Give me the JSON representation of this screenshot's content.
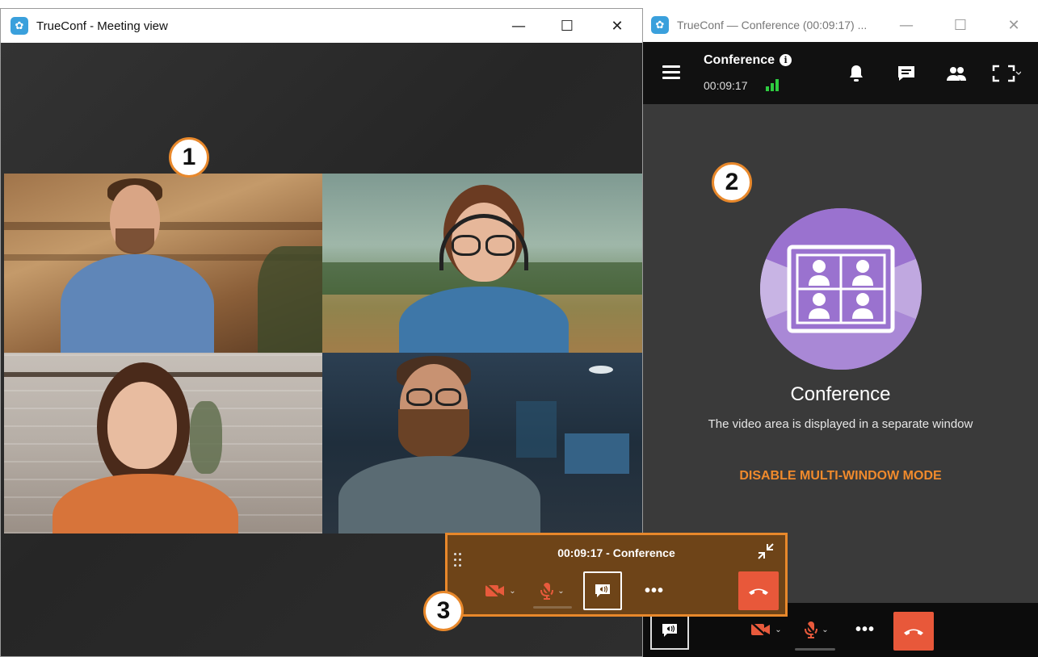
{
  "meeting_window": {
    "title": "TrueConf - Meeting view",
    "controls": {
      "minimize": "—",
      "maximize": "☐",
      "close": "✕"
    },
    "badge": "1"
  },
  "conference_window": {
    "title": "TrueConf — Conference (00:09:17) ...",
    "controls": {
      "minimize": "—",
      "maximize": "☐",
      "close": "✕"
    },
    "header": {
      "conference_name": "Conference",
      "timer": "00:09:17"
    },
    "badge": "2",
    "placeholder": {
      "title": "Conference",
      "subtitle": "The video area is displayed in a separate window",
      "action": "DISABLE MULTI-WINDOW MODE"
    },
    "bottom_dots": "•••"
  },
  "mini_panel": {
    "title": "00:09:17 - Conference",
    "dots": "•••",
    "badge": "3"
  },
  "colors": {
    "accent_orange": "#e8882b",
    "end_call_red": "#e8583a",
    "signal_green": "#2ecc40",
    "conference_purple": "#b79bdb"
  },
  "icons": [
    "hamburger-icon",
    "info-icon",
    "signal-icon",
    "bell-icon",
    "chat-icon",
    "participants-icon",
    "fullscreen-icon",
    "camera-off-icon",
    "mic-off-icon",
    "speaker-icon",
    "more-icon",
    "end-call-icon",
    "collapse-icon",
    "drag-handle-icon"
  ]
}
